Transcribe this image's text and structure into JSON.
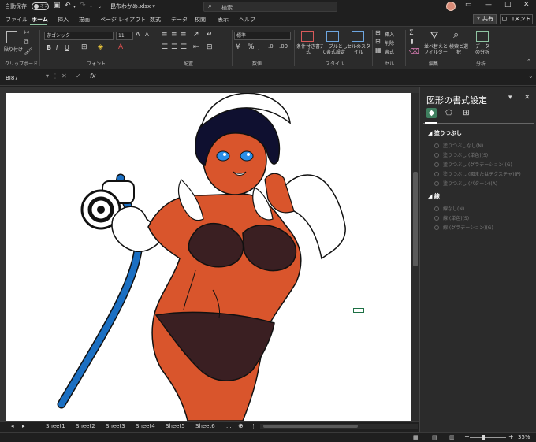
{
  "titlebar": {
    "autosave_label": "自動保存",
    "autosave_state": "オフ",
    "document_title": "昆布わかめ.xlsx ▾",
    "search_placeholder": "検索"
  },
  "tabs": [
    "ファイル",
    "ホーム",
    "挿入",
    "描画",
    "ページ レイアウト",
    "数式",
    "データ",
    "校閲",
    "表示",
    "ヘルプ"
  ],
  "active_tab": "ホーム",
  "share_label": "共有",
  "comment_label": "コメント",
  "ribbon": {
    "paste_label": "貼り付け",
    "font_name": "游ゴシック",
    "font_size": "11",
    "number_format": "標準",
    "conditional_format": "条件付き書式",
    "format_as_table": "テーブルとして書式設定",
    "cell_styles": "セルのスタイル",
    "insert": "挿入",
    "delete": "削除",
    "format": "書式",
    "sort_filter": "並べ替えとフィルター",
    "find_select": "検索と選択",
    "analyze_data": "データの分析",
    "groups": {
      "clipboard": "クリップボード",
      "font": "フォント",
      "alignment": "配置",
      "number": "数値",
      "styles": "スタイル",
      "cells": "セル",
      "editing": "編集",
      "analysis": "分析"
    }
  },
  "formula_bar": {
    "name_box": "BI87",
    "fx": "fx",
    "value": ""
  },
  "sheets": [
    "Sheet1",
    "Sheet2",
    "Sheet3",
    "Sheet4",
    "Sheet5",
    "Sheet6"
  ],
  "sheet_more": "...",
  "status": {
    "zoom": "35%"
  },
  "format_pane": {
    "title": "図形の書式設定",
    "fill_section": "塗りつぶし",
    "fill_options": [
      "塗りつぶしなし(N)",
      "塗りつぶし (単色)(S)",
      "塗りつぶし (グラデーション)(G)",
      "塗りつぶし (図またはテクスチャ)(P)",
      "塗りつぶし (パターン)(A)"
    ],
    "line_section": "線",
    "line_options": [
      "線なし(N)",
      "線 (単色)(S)",
      "線 (グラデーション)(G)"
    ]
  },
  "colors": {
    "accent": "#8fc4a2",
    "skin": "#d9552c",
    "outfit": "#3a1f22",
    "hose": "#1b6fc2"
  }
}
